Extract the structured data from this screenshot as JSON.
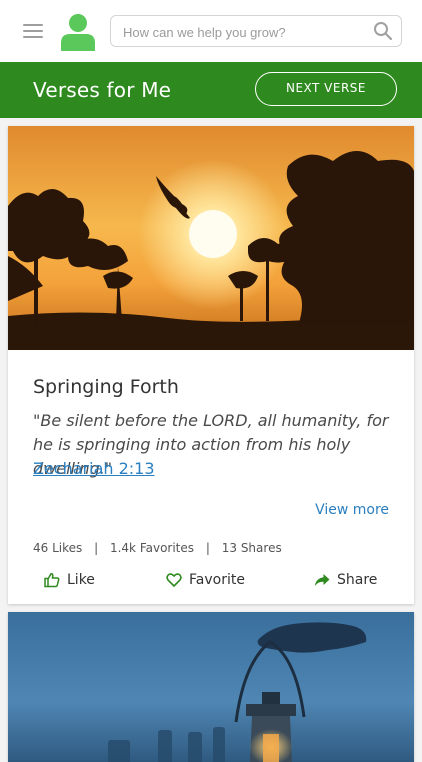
{
  "header": {
    "search_placeholder": "How can we help you grow?"
  },
  "banner": {
    "title": "Verses for Me",
    "next_button": "NEXT VERSE"
  },
  "cards": [
    {
      "title": "Springing Forth",
      "verse": "\"Be silent before the LORD, all humanity, for he is springing into action from his holy dwelling.\"",
      "reference": "Zechariah 2:13",
      "view_more": "View more",
      "stats": {
        "likes": "46 Likes",
        "favorites": "1.4k Favorites",
        "shares": "13 Shares",
        "separator": "|"
      },
      "actions": {
        "like": "Like",
        "favorite": "Favorite",
        "share": "Share"
      }
    }
  ],
  "colors": {
    "brand_green": "#2e8a1e",
    "link_blue": "#2a7fc0",
    "avatar_green": "#5ac85a"
  }
}
